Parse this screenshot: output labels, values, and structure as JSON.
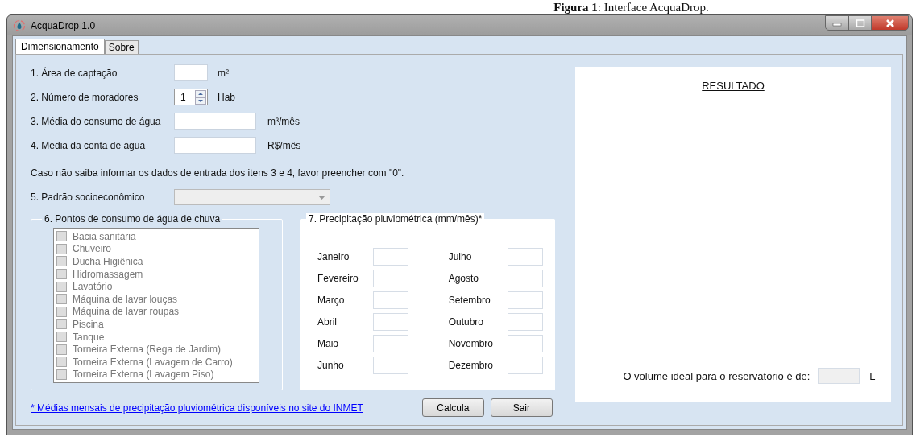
{
  "caption": "**Figura 1**: Interface AcquaDrop.",
  "window": {
    "title": "AcquaDrop 1.0"
  },
  "tabs": [
    {
      "label": "Dimensionamento",
      "selected": true
    },
    {
      "label": "Sobre",
      "selected": false
    }
  ],
  "fields": [
    {
      "kind": "small",
      "label": "1. Área de captação",
      "unit": "m²"
    },
    {
      "kind": "spinner",
      "label": "2. Número de moradores",
      "value": "1",
      "unit": "Hab"
    },
    {
      "kind": "wide",
      "label": "3. Média do consumo de água",
      "unit": "m³/mês"
    },
    {
      "kind": "wide",
      "label": "4. Média da conta de água",
      "unit": "R$/mês"
    }
  ],
  "note": "Caso não saiba informar os dados de entrada dos itens 3 e 4, favor preencher com \"0\".",
  "socioeconomic": {
    "label": "5. Padrão socioeconômico",
    "disabled": true
  },
  "consumption_points": {
    "title": "6. Pontos de consumo de água de chuva",
    "disabled": true,
    "items": [
      {
        "label": "Bacia sanitária",
        "checked": false
      },
      {
        "label": "Chuveiro",
        "checked": false
      },
      {
        "label": "Ducha Higiênica",
        "checked": false
      },
      {
        "label": "Hidromassagem",
        "checked": false
      },
      {
        "label": "Lavatório",
        "checked": false
      },
      {
        "label": "Máquina de lavar louças",
        "checked": false
      },
      {
        "label": "Máquina de lavar roupas",
        "checked": false
      },
      {
        "label": "Piscina",
        "checked": false
      },
      {
        "label": "Tanque",
        "checked": false
      },
      {
        "label": "Torneira Externa (Rega de Jardim)",
        "checked": false
      },
      {
        "label": "Torneira Externa (Lavagem de Carro)",
        "checked": false
      },
      {
        "label": "Torneira Externa (Lavagem Piso)",
        "checked": false
      }
    ]
  },
  "rainfall": {
    "title": "7. Precipitação pluviométrica (mm/mês)*",
    "months": [
      {
        "label": "Janeiro"
      },
      {
        "label": "Fevereiro"
      },
      {
        "label": "Março"
      },
      {
        "label": "Abril"
      },
      {
        "label": "Maio"
      },
      {
        "label": "Junho"
      },
      {
        "label": "Julho"
      },
      {
        "label": "Agosto"
      },
      {
        "label": "Setembro"
      },
      {
        "label": "Outubro"
      },
      {
        "label": "Novembro"
      },
      {
        "label": "Dezembro"
      }
    ]
  },
  "link": "* Médias mensais de precipitação pluviométrica disponíveis no site do INMET",
  "buttons": [
    "Calcula",
    "Sair"
  ],
  "result": {
    "title": "RESULTADO",
    "volume_label": "O volume ideal para o reservatório é de:",
    "volume_disabled": true,
    "unit": "L"
  }
}
